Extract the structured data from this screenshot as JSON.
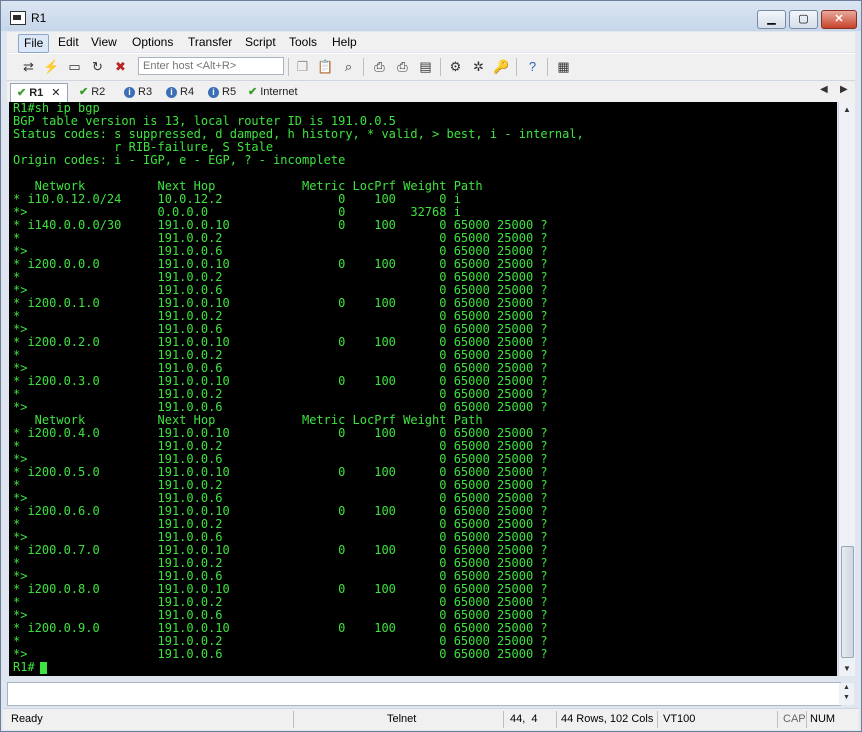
{
  "window": {
    "title": "R1",
    "min_label": "▁",
    "max_label": "▢",
    "close_label": "✕"
  },
  "menu": {
    "items": [
      "File",
      "Edit",
      "View",
      "Options",
      "Transfer",
      "Script",
      "Tools",
      "Help"
    ]
  },
  "toolbar": {
    "host_placeholder": "Enter host <Alt+R>"
  },
  "tabs": [
    {
      "label": "R1",
      "status": "connected",
      "close": "✕"
    },
    {
      "label": "R2",
      "status": "connected"
    },
    {
      "label": "R3",
      "status": "info"
    },
    {
      "label": "R4",
      "status": "info"
    },
    {
      "label": "R5",
      "status": "info"
    },
    {
      "label": "Internet",
      "status": "connected"
    }
  ],
  "terminal": {
    "text": "R1#sh ip bgp\nBGP table version is 13, local router ID is 191.0.0.5\nStatus codes: s suppressed, d damped, h history, * valid, > best, i - internal,\n              r RIB-failure, S Stale\nOrigin codes: i - IGP, e - EGP, ? - incomplete\n\n   Network          Next Hop            Metric LocPrf Weight Path\n* i10.0.12.0/24     10.0.12.2                0    100      0 i\n*>                  0.0.0.0                  0         32768 i\n* i140.0.0.0/30     191.0.0.10               0    100      0 65000 25000 ?\n*                   191.0.0.2                              0 65000 25000 ?\n*>                  191.0.0.6                              0 65000 25000 ?\n* i200.0.0.0        191.0.0.10               0    100      0 65000 25000 ?\n*                   191.0.0.2                              0 65000 25000 ?\n*>                  191.0.0.6                              0 65000 25000 ?\n* i200.0.1.0        191.0.0.10               0    100      0 65000 25000 ?\n*                   191.0.0.2                              0 65000 25000 ?\n*>                  191.0.0.6                              0 65000 25000 ?\n* i200.0.2.0        191.0.0.10               0    100      0 65000 25000 ?\n*                   191.0.0.2                              0 65000 25000 ?\n*>                  191.0.0.6                              0 65000 25000 ?\n* i200.0.3.0        191.0.0.10               0    100      0 65000 25000 ?\n*                   191.0.0.2                              0 65000 25000 ?\n*>                  191.0.0.6                              0 65000 25000 ?\n   Network          Next Hop            Metric LocPrf Weight Path\n* i200.0.4.0        191.0.0.10               0    100      0 65000 25000 ?\n*                   191.0.0.2                              0 65000 25000 ?\n*>                  191.0.0.6                              0 65000 25000 ?\n* i200.0.5.0        191.0.0.10               0    100      0 65000 25000 ?\n*                   191.0.0.2                              0 65000 25000 ?\n*>                  191.0.0.6                              0 65000 25000 ?\n* i200.0.6.0        191.0.0.10               0    100      0 65000 25000 ?\n*                   191.0.0.2                              0 65000 25000 ?\n*>                  191.0.0.6                              0 65000 25000 ?\n* i200.0.7.0        191.0.0.10               0    100      0 65000 25000 ?\n*                   191.0.0.2                              0 65000 25000 ?\n*>                  191.0.0.6                              0 65000 25000 ?\n* i200.0.8.0        191.0.0.10               0    100      0 65000 25000 ?\n*                   191.0.0.2                              0 65000 25000 ?\n*>                  191.0.0.6                              0 65000 25000 ?\n* i200.0.9.0        191.0.0.10               0    100      0 65000 25000 ?\n*                   191.0.0.2                              0 65000 25000 ?\n*>                  191.0.0.6                              0 65000 25000 ?\nR1#",
    "fg_color": "#3fe33f",
    "bg_color": "#000000"
  },
  "status": {
    "ready": "Ready",
    "protocol": "Telnet",
    "cursor_pos": "44,  4",
    "dimensions": "44 Rows, 102 Cols",
    "emulation": "VT100",
    "cap": "CAP",
    "num": "NUM"
  },
  "icons": [
    "connect-icon",
    "quick-connect-icon",
    "connect-in-tab-icon",
    "reconnect-icon",
    "disconnect-icon",
    "copy-icon",
    "paste-icon",
    "find-icon",
    "print-icon",
    "print-setup-icon",
    "print-screen-icon",
    "session-options-icon",
    "global-options-icon",
    "keymap-icon",
    "help-icon",
    "sftp-icon"
  ]
}
